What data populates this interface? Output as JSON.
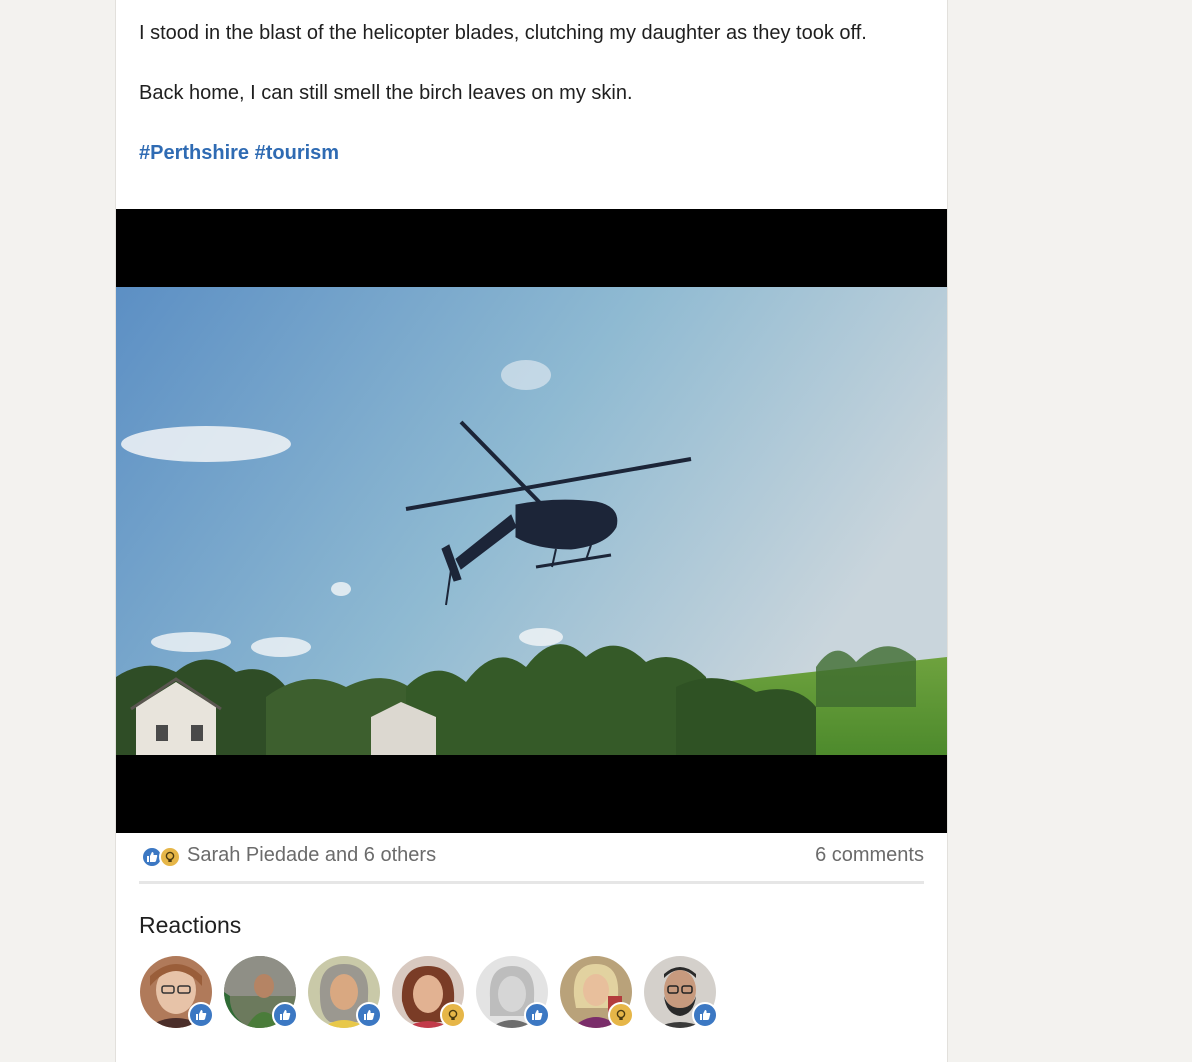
{
  "post": {
    "paragraph_1": "I stood in the blast of the helicopter blades, clutching my daughter as they took off.",
    "paragraph_2": "Back home, I can still smell the birch leaves on my skin.",
    "hashtags": [
      "#Perthshire",
      "#tourism"
    ]
  },
  "social": {
    "reaction_icons": [
      "like-icon",
      "insightful-icon"
    ],
    "reactors_text": "Sarah Piedade and 6 others",
    "comments_text": "6 comments"
  },
  "reactions": {
    "title": "Reactions",
    "people": [
      {
        "reaction": "like"
      },
      {
        "reaction": "like"
      },
      {
        "reaction": "like"
      },
      {
        "reaction": "insightful"
      },
      {
        "reaction": "like"
      },
      {
        "reaction": "insightful"
      },
      {
        "reaction": "like"
      }
    ]
  },
  "colors": {
    "hashtag": "#2f6bb3",
    "like": "#3c78c3",
    "insightful": "#e6b648",
    "text": "#1f1f1f",
    "muted": "#6b6b6b",
    "page_bg": "#f3f2ef"
  }
}
